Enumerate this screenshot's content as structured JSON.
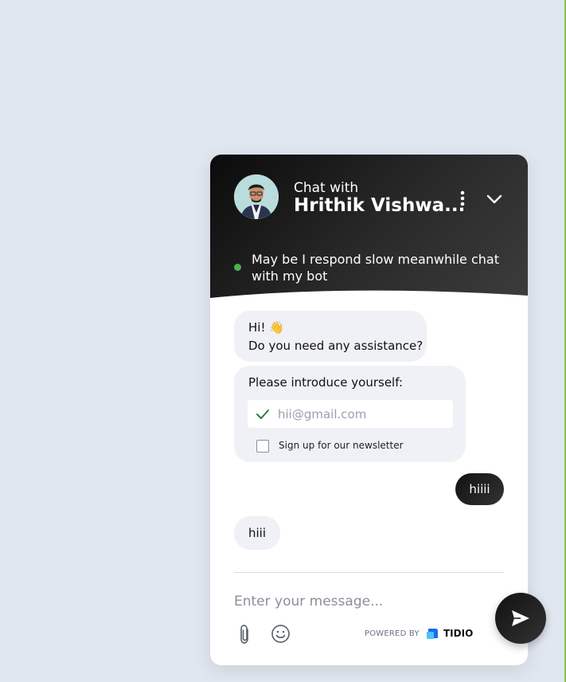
{
  "header": {
    "subtitle": "Chat with",
    "agent_name": "Hrithik Vishwa...",
    "status_text": "May be I respond slow meanwhile chat with my bot",
    "status_color": "#4caf50"
  },
  "messages": {
    "greeting_line1": "Hi! 👋",
    "greeting_line2": "Do you need any assistance?",
    "intro_label": "Please introduce yourself:",
    "email_value": "",
    "email_placeholder": "hii@gmail.com",
    "newsletter_label": "Sign up for our newsletter",
    "visitor_message": "hiiii",
    "bot_reply": "hiii"
  },
  "composer": {
    "placeholder": "Enter your message...",
    "powered_by": "POWERED BY",
    "brand": "TIDIO"
  },
  "icons": {
    "menu": "vertical-dots-icon",
    "collapse": "chevron-down-icon",
    "attach": "paperclip-icon",
    "emoji": "smiley-icon",
    "send": "send-icon",
    "check": "checkmark-icon"
  },
  "colors": {
    "page_background": "#e1e7f0",
    "header_dark": "#0b0b0b",
    "bubble_background": "#f0f1f6",
    "check_green": "#2e7d32"
  }
}
